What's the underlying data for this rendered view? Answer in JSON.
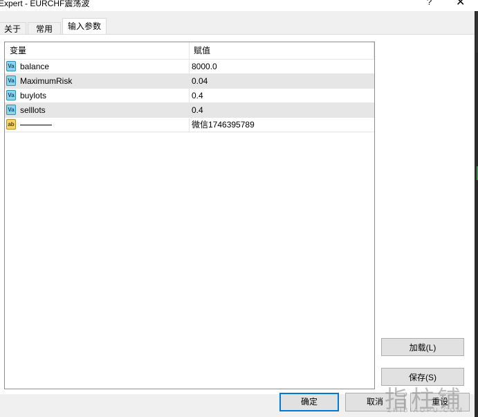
{
  "window": {
    "title": "Expert - EURCHF震荡波",
    "help_label": "?",
    "close_label": "✕"
  },
  "tabs": [
    {
      "label": "关于",
      "active": false
    },
    {
      "label": "常用",
      "active": false
    },
    {
      "label": "输入参数",
      "active": true
    }
  ],
  "grid": {
    "headers": {
      "variable": "变量",
      "value": "赋值"
    },
    "rows": [
      {
        "icon": "variable-icon",
        "icon_text": "Va",
        "name": "balance",
        "value": "8000.0"
      },
      {
        "icon": "variable-icon",
        "icon_text": "Va",
        "name": "MaximumRisk",
        "value": "0.04"
      },
      {
        "icon": "variable-icon",
        "icon_text": "Va",
        "name": "buylots",
        "value": "0.4"
      },
      {
        "icon": "variable-icon",
        "icon_text": "Va",
        "name": "selllots",
        "value": "0.4"
      },
      {
        "icon": "string-icon",
        "icon_text": "ab",
        "name": "",
        "value": "微信1746395789"
      }
    ]
  },
  "buttons": {
    "load": "加载(L)",
    "save": "保存(S)",
    "ok": "确定",
    "cancel": "取消",
    "reset": "重设"
  },
  "watermark": {
    "main": "指柱铺",
    "sub": "ZHIBIAOPU.COM"
  },
  "colors": {
    "accent": "#0078d7",
    "variable_icon": "#8fd3ea",
    "string_icon": "#f3d56b",
    "alt_row": "#e6e6e6"
  }
}
